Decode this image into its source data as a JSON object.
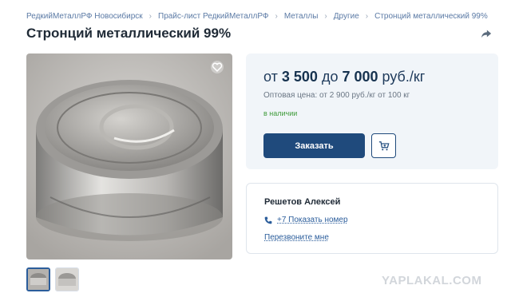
{
  "breadcrumb": [
    "РедкийМеталлРФ Новосибирск",
    "Прайс-лист РедкийМеталлРФ",
    "Металлы",
    "Другие",
    "Стронций металлический 99%"
  ],
  "breadcrumb_sep": "›",
  "title": "Стронций металлический 99%",
  "icons": {
    "share": "share-icon",
    "favorite": "heart-icon",
    "cart": "cart-icon",
    "phone": "phone-icon"
  },
  "price": {
    "from_word": "от",
    "min": "3 500",
    "to_word": "до",
    "max": "7 000",
    "unit": "руб./кг"
  },
  "wholesale": "Оптовая цена: от 2 900 руб./кг от 100 кг",
  "stock": "в наличии",
  "order_label": "Заказать",
  "seller": {
    "name": "Решетов Алексей",
    "phone": "+7 Показать номер",
    "callback": "Перезвоните мне"
  },
  "watermark": "YAPLAKAL.COM",
  "colors": {
    "accent": "#1f4a7c",
    "link": "#2b5d9b",
    "stock": "#3f9b3a",
    "card_bg": "#f1f5f9"
  }
}
